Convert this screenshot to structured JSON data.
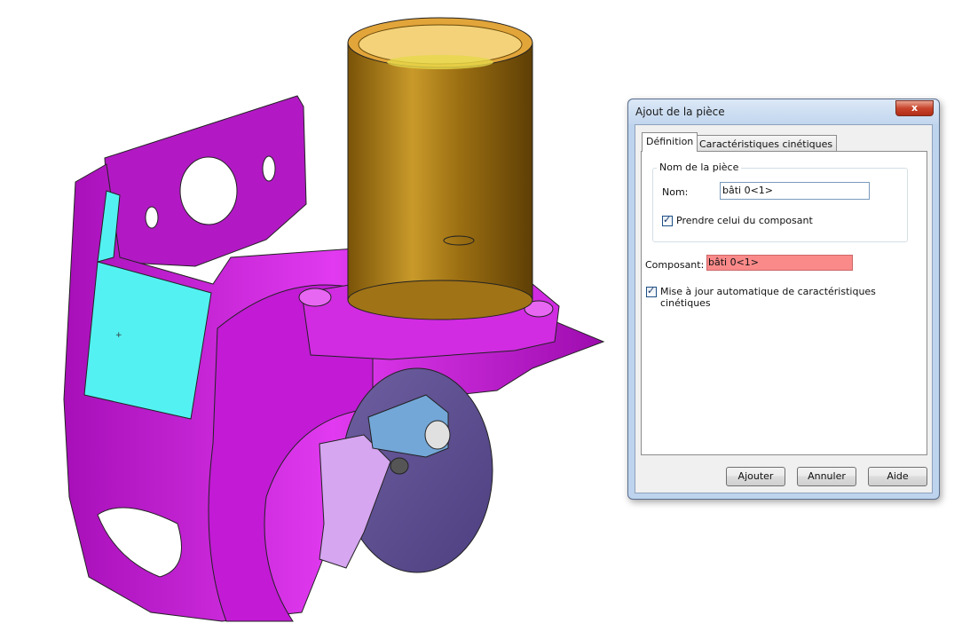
{
  "dialog": {
    "title": "Ajout de la pièce",
    "close_label": "x",
    "tabs": [
      "Définition",
      "Caractéristiques cinétiques"
    ],
    "group_title": "Nom de la pièce",
    "nom_label": "Nom:",
    "nom_value": "bâti 0<1>",
    "prendre_label": "Prendre celui du composant",
    "prendre_checked": true,
    "composant_label": "Composant:",
    "composant_value": "bâti 0<1>",
    "composant_highlight": "#fa8a8a",
    "maj_label": "Mise à jour automatique de caractéristiques cinétiques",
    "maj_checked": true,
    "buttons": {
      "add": "Ajouter",
      "cancel": "Annuler",
      "help": "Aide"
    }
  },
  "scene": {
    "part_color": "#cc1fdd",
    "face_highlight": "#53f1f1",
    "cylinder_color": "#b58518"
  }
}
